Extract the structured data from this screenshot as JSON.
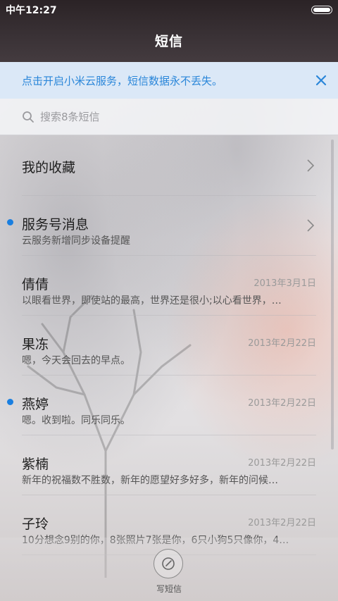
{
  "status_bar": {
    "time": "中午12:27"
  },
  "header": {
    "title": "短信"
  },
  "cloud_banner": {
    "text": "点击开启小米云服务，短信数据永不丢失。"
  },
  "search": {
    "placeholder": "搜索8条短信"
  },
  "favorites": {
    "label": "我的收藏"
  },
  "conversations": [
    {
      "name": "服务号消息",
      "preview": "云服务新增同步设备提醒",
      "date": "",
      "unread": true,
      "chevron": true
    },
    {
      "name": "倩倩",
      "preview": "以眼看世界，即使站的最高，世界还是很小;以心看世界，…",
      "date": "2013年3月1日",
      "unread": false
    },
    {
      "name": "果冻",
      "preview": "嗯，今天会回去的早点。",
      "date": "2013年2月22日",
      "unread": false
    },
    {
      "name": "燕婷",
      "preview": "嗯。收到啦。同乐同乐。",
      "date": "2013年2月22日",
      "unread": true
    },
    {
      "name": "紫楠",
      "preview": "新年的祝福数不胜数，新年的愿望好多好多，新年的问候…",
      "date": "2013年2月22日",
      "unread": false
    },
    {
      "name": "子玲",
      "preview": "10分想念9别的你，8张照片7张是你，6只小狗5只像你，4…",
      "date": "2013年2月22日",
      "unread": false
    }
  ],
  "compose": {
    "label": "写短信"
  },
  "colors": {
    "accent": "#1a7fe0",
    "banner_bg": "#dbe8f7",
    "banner_text": "#2a86d9"
  }
}
